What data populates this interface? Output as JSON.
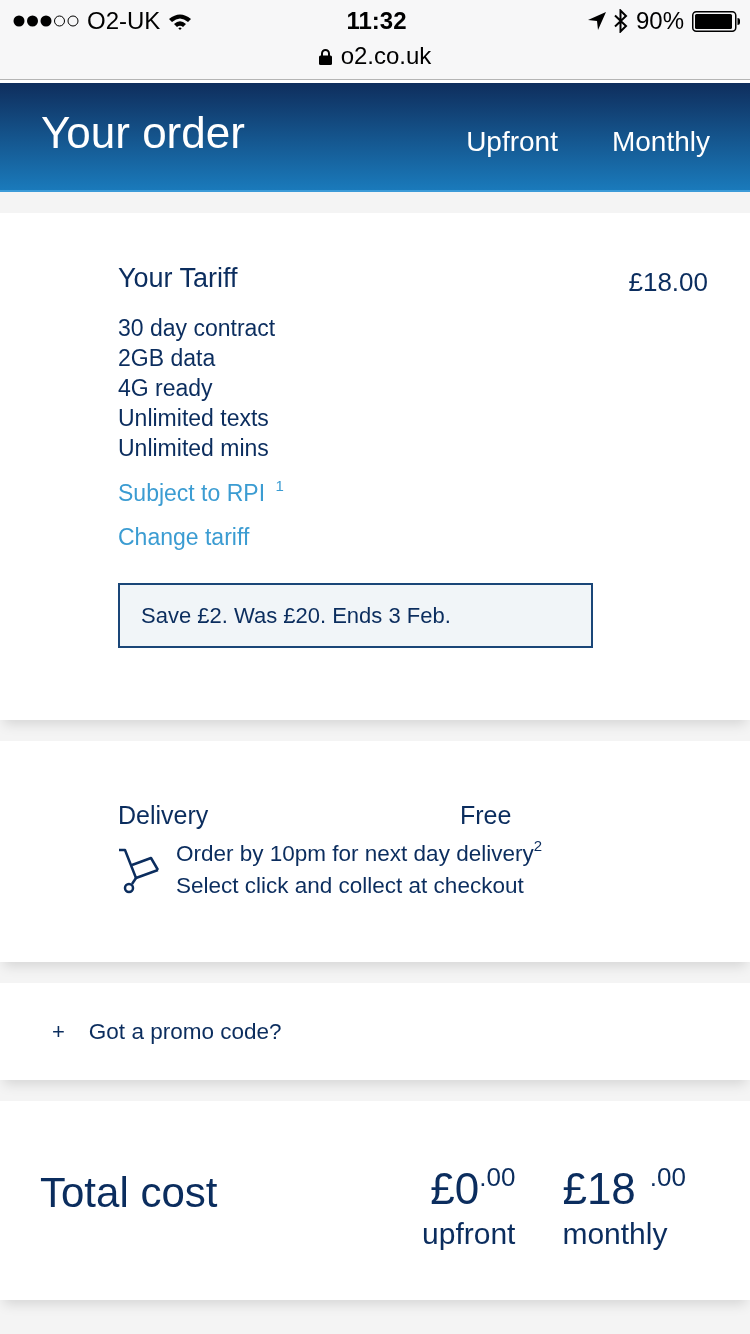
{
  "status_bar": {
    "carrier": "O2-UK",
    "time": "11:32",
    "battery": "90%"
  },
  "address_bar": {
    "url": "o2.co.uk"
  },
  "header": {
    "title": "Your order",
    "columns": [
      "Upfront",
      "Monthly"
    ]
  },
  "tariff": {
    "title": "Your Tariff",
    "price": "£18.00",
    "features": [
      "30 day contract",
      "2GB data",
      "4G ready",
      "Unlimited texts",
      "Unlimited mins"
    ],
    "links": [
      "Subject to RPI $^{1}$",
      "Change tariff"
    ],
    "offer": "Save £2. Was £20. Ends 3 Feb."
  },
  "delivery": {
    "label": "Delivery",
    "price": "Free",
    "lines": [
      "Order by 10pm for next day delivery$^{2}$",
      "Select click and collect at checkout"
    ]
  },
  "promo": {
    "toggle": "+",
    "label": "Got a promo code?"
  },
  "total": {
    "label": "Total cost",
    "prices": [
      {
        "amount": "£0",
        "pence": ".00",
        "period": "upfront"
      },
      {
        "amount": "£18",
        "pence": ".00",
        "period": "monthly"
      }
    ]
  }
}
